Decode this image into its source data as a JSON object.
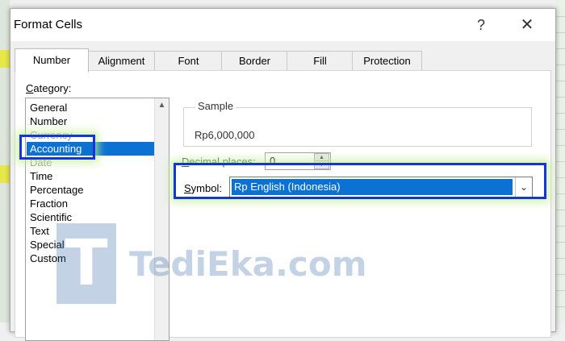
{
  "window": {
    "title": "Format Cells",
    "help_glyph": "?",
    "close_glyph": "✕"
  },
  "tabs": [
    {
      "label": "Number"
    },
    {
      "label": "Alignment"
    },
    {
      "label": "Font"
    },
    {
      "label": "Border"
    },
    {
      "label": "Fill"
    },
    {
      "label": "Protection"
    }
  ],
  "category": {
    "label_prefix": "C",
    "label_rest": "ategory:",
    "items": [
      "General",
      "Number",
      "Currency",
      "Accounting",
      "Date",
      "Time",
      "Percentage",
      "Fraction",
      "Scientific",
      "Text",
      "Special",
      "Custom"
    ],
    "selected": "Accounting",
    "scroll_up_glyph": "▲"
  },
  "sample": {
    "title": "Sample",
    "value": "Rp6,000,000"
  },
  "decimal": {
    "label_prefix": "D",
    "label_rest": "ecimal places:",
    "value": "0",
    "up_glyph": "▲",
    "down_glyph": "▼"
  },
  "symbol": {
    "label_prefix": "S",
    "label_rest": "ymbol:",
    "value": "Rp English (Indonesia)",
    "arrow_glyph": "⌄"
  },
  "watermark": {
    "logo_letter": "T",
    "text": "TediEka.com"
  },
  "colors": {
    "accent": "#0b72d3",
    "highlight_border": "#1536d6",
    "highlight_glow": "#bef08c"
  }
}
